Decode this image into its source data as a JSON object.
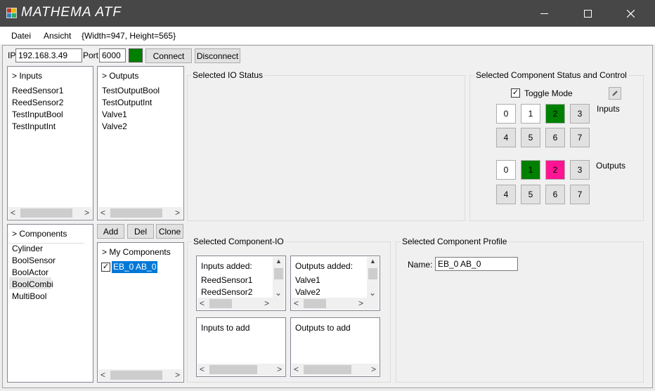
{
  "window": {
    "title": "MATHEMA  ATF"
  },
  "menu": {
    "items": [
      "Datei",
      "Ansicht"
    ],
    "size_info": "{Width=947, Height=565}"
  },
  "connection": {
    "ip_label": "IP",
    "ip_value": "192.168.3.49",
    "port_label": "Port",
    "port_value": "6000",
    "status_color": "#008000",
    "connect_label": "Connect",
    "disconnect_label": "Disconnect"
  },
  "inputs": {
    "header": "> Inputs",
    "items": [
      "ReedSensor1",
      "ReedSensor2",
      "TestInputBool",
      "TestInputInt"
    ]
  },
  "outputs": {
    "header": "> Outputs",
    "items": [
      "TestOutputBool",
      "TestOutputInt",
      "Valve1",
      "Valve2"
    ]
  },
  "components": {
    "header": "> Components",
    "items": [
      "Cylinder",
      "BoolSensor",
      "BoolActor",
      "BoolCombi",
      "MultiBool"
    ]
  },
  "component_buttons": {
    "add": "Add",
    "del": "Del",
    "clone": "Clone"
  },
  "my_components": {
    "header": "> My Components",
    "items": [
      {
        "label": "EB_0 AB_0",
        "checked": true
      }
    ]
  },
  "io_status": {
    "title": "Selected IO Status"
  },
  "status_control": {
    "title": "Selected Component Status and Control",
    "toggle_label": "Toggle Mode",
    "toggle_checked": true,
    "inputs_label": "Inputs",
    "outputs_label": "Outputs",
    "input_buttons": [
      "0",
      "1",
      "2",
      "3",
      "4",
      "5",
      "6",
      "7"
    ],
    "output_buttons": [
      "0",
      "1",
      "2",
      "3",
      "4",
      "5",
      "6",
      "7"
    ],
    "colors": {
      "active_green": "#008000",
      "active_pink": "#ff1493",
      "white": "#ffffff",
      "inactive": "#e1e1e1"
    }
  },
  "component_io": {
    "title": "Selected Component-IO",
    "inputs_added_header": "Inputs added:",
    "inputs_added": [
      "ReedSensor1",
      "ReedSensor2"
    ],
    "outputs_added_header": "Outputs added:",
    "outputs_added": [
      "Valve1",
      "Valve2"
    ],
    "inputs_to_add_header": "Inputs to add",
    "outputs_to_add_header": "Outputs to add"
  },
  "profile": {
    "title": "Selected Component Profile",
    "name_label": "Name:",
    "name_value": "EB_0 AB_0"
  }
}
